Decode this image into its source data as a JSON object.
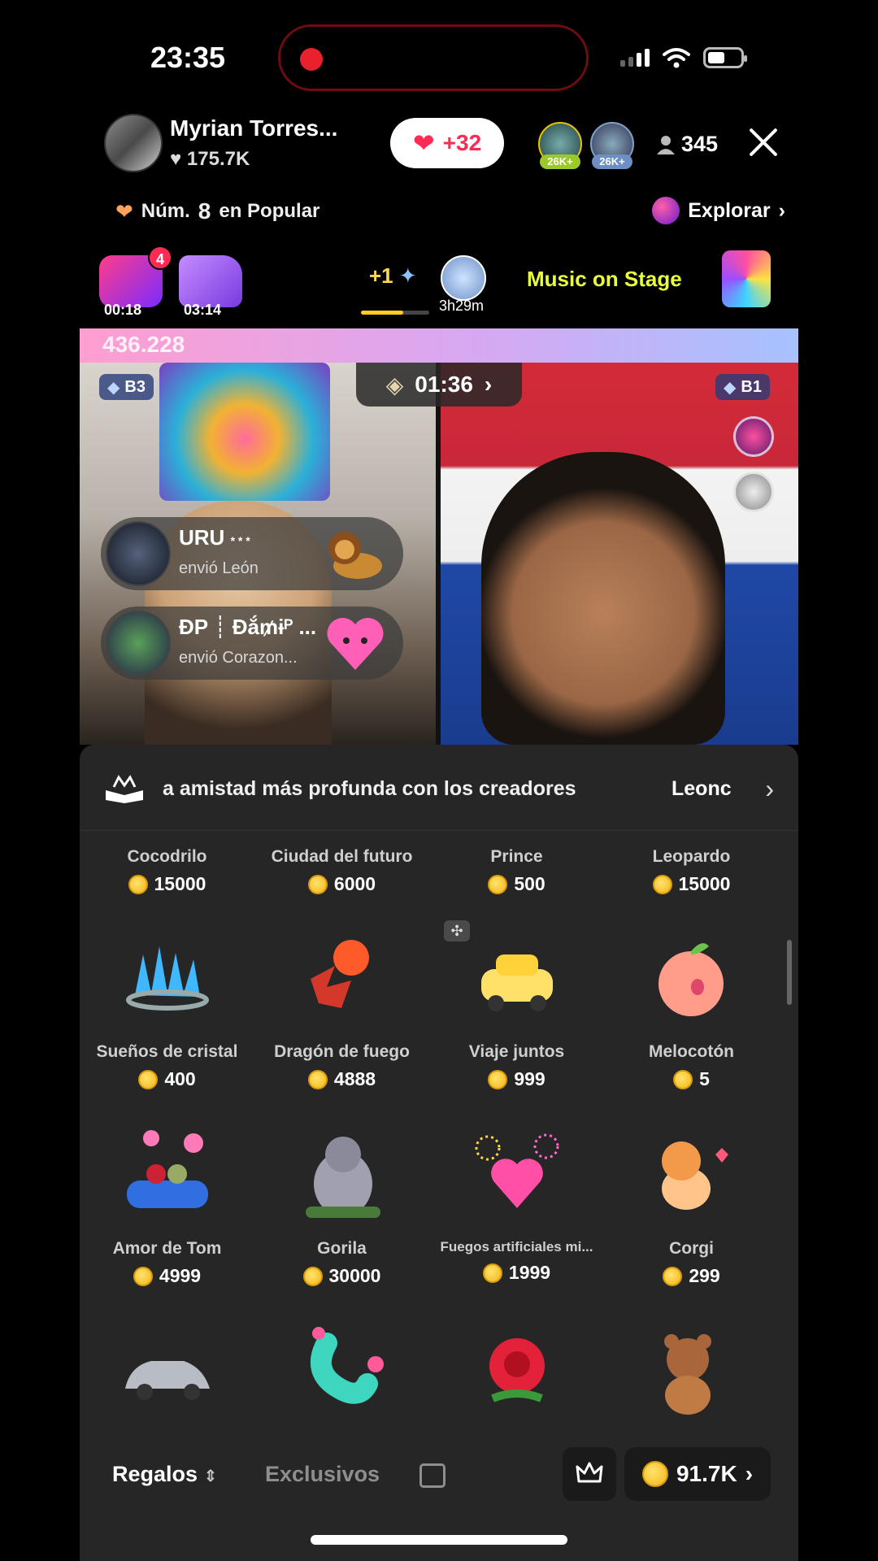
{
  "status": {
    "time": "23:35"
  },
  "host": {
    "name": "Myrian Torres...",
    "likes": "175.7K",
    "follow_label": "+32",
    "viewer_count": "345"
  },
  "top_viewers": [
    {
      "badge": "26K+"
    },
    {
      "badge": "26K+"
    }
  ],
  "rank": {
    "prefix": "Núm.",
    "number": "8",
    "suffix": "en Popular"
  },
  "explore_label": "Explorar",
  "events": {
    "left_timer": "00:18",
    "left_notif": "4",
    "right_timer": "03:14",
    "boost": "+1",
    "boost_progress": 0.62,
    "tiger_time": "3h29m",
    "stage_label": "Music on Stage"
  },
  "battle": {
    "score": "436.228",
    "timer": "01:36",
    "left_tag": "B3",
    "right_tag": "B1",
    "messages": [
      {
        "name": "URU",
        "sub": "* * *",
        "action": "envió  León"
      },
      {
        "name": "ĐP ┊ Đắ₥ɨᴾ ...",
        "action": "envió  Corazon..."
      }
    ]
  },
  "panel": {
    "banner_text": "a amistad más profunda con los creadores",
    "banner_next": "Leonc",
    "gifts": [
      {
        "name": "Cocodrilo",
        "price": "15000"
      },
      {
        "name": "Ciudad del futuro",
        "price": "6000"
      },
      {
        "name": "Prince",
        "price": "500"
      },
      {
        "name": "Leopardo",
        "price": "15000"
      },
      {
        "name": "Sueños de cristal",
        "price": "400"
      },
      {
        "name": "Dragón de fuego",
        "price": "4888"
      },
      {
        "name": "Viaje juntos",
        "price": "999"
      },
      {
        "name": "Melocotón",
        "price": "5"
      },
      {
        "name": "Amor de Tom",
        "price": "4999"
      },
      {
        "name": "Gorila",
        "price": "30000"
      },
      {
        "name": "Fuegos artificiales mi...",
        "price": "1999"
      },
      {
        "name": "Corgi",
        "price": "299"
      }
    ],
    "tabs": {
      "gifts": "Regalos",
      "exclusive": "Exclusivos"
    },
    "coins": "91.7K"
  }
}
